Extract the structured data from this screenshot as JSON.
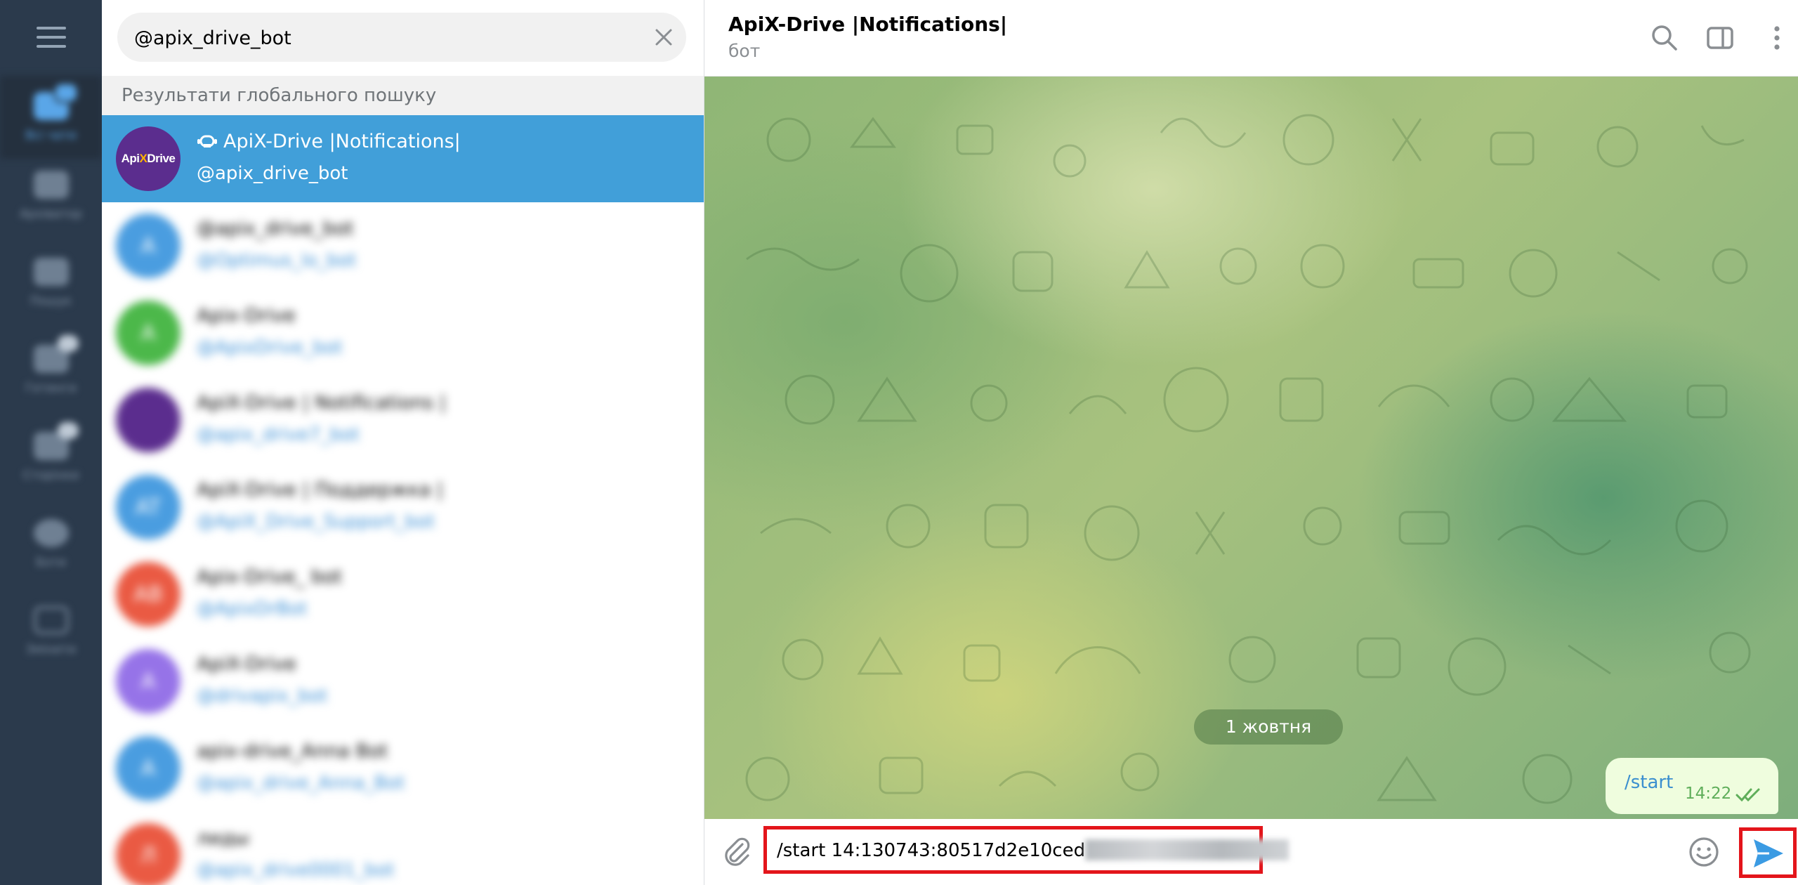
{
  "rail": {
    "folders": [
      {
        "label": "Всі чати",
        "icon": "chats-folder-icon"
      },
      {
        "label": "Архіватор",
        "icon": "folder-icon"
      },
      {
        "label": "Пошук",
        "icon": "folder-icon"
      },
      {
        "label": "Гетинги",
        "icon": "folder-icon"
      },
      {
        "label": "Сторінки",
        "icon": "folder-icon"
      },
      {
        "label": "Боти",
        "icon": "bot-folder-icon"
      },
      {
        "label": "Змінити",
        "icon": "edit-folders-icon"
      }
    ]
  },
  "search": {
    "query": "@apix_drive_bot",
    "section_title": "Результати глобального пошуку"
  },
  "results": [
    {
      "name": "ApiX-Drive |Notifications|",
      "handle": "@apix_drive_bot",
      "avatar_letter": "",
      "avatar_color": "#5b2d8e",
      "avatar_logo": "ApiXDrive",
      "selected": true
    },
    {
      "name": "@apix_drive_bot",
      "handle": "@Optimus_lo_bot",
      "avatar_letter": "A",
      "avatar_color": "#4a9de0"
    },
    {
      "name": "Apix-Drive",
      "handle": "@ApixDrive_bot",
      "avatar_letter": "A",
      "avatar_color": "#4cb84a"
    },
    {
      "name": "ApiX-Drive | Notifications |",
      "handle": "@apix_drive7_bot",
      "avatar_letter": "",
      "avatar_color": "#5b2d8e"
    },
    {
      "name": "ApiX-Drive | Поддержка |",
      "handle": "@ApiX_Drive_Support_bot",
      "avatar_letter": "AT",
      "avatar_color": "#4a9de0"
    },
    {
      "name": "Apix-Drive_ bot",
      "handle": "@ApixDrBot",
      "avatar_letter": "AB",
      "avatar_color": "#ea5a43"
    },
    {
      "name": "ApiX-Drive",
      "handle": "@drivapix_bot",
      "avatar_letter": "A",
      "avatar_color": "#9673e8"
    },
    {
      "name": "apix-drive_Anna Bot",
      "handle": "@apix_drive_Anna_Bot",
      "avatar_letter": "A",
      "avatar_color": "#4a9de0"
    },
    {
      "name": "лиды",
      "handle": "@apix_drive0001_bot",
      "avatar_letter": "Л",
      "avatar_color": "#ea5a43"
    }
  ],
  "chat": {
    "title": "ApiX-Drive |Notifications|",
    "subtitle": "бот",
    "date_separator": "1 жовтня",
    "message": {
      "text": "/start",
      "time": "14:22"
    },
    "composer_text": "/start 14:130743:80517d2e10ced"
  },
  "colors": {
    "accent": "#419fd9",
    "highlight": "#e3151b",
    "rail_bg": "#2b3a4c"
  }
}
